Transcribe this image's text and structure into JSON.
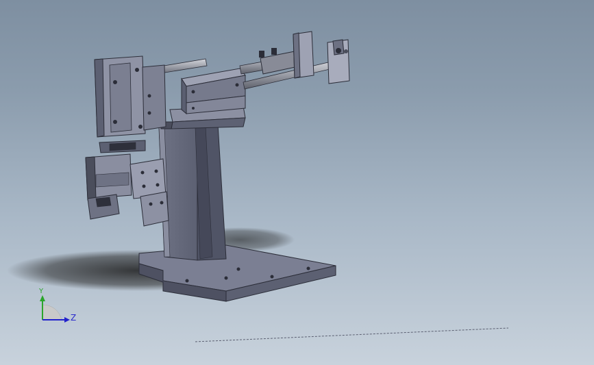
{
  "viewport": {
    "background_top": "#7e8fa1",
    "background_bottom": "#c8d2dc"
  },
  "triad": {
    "y_label": "Y",
    "z_label": "Z",
    "y_color": "#2aa52a",
    "z_color": "#2222cc"
  },
  "model": {
    "steel_color": "#6e7284",
    "steel_dark": "#3c3f4d",
    "steel_light": "#9a9eb0",
    "rod_color": "#a9acb4"
  }
}
